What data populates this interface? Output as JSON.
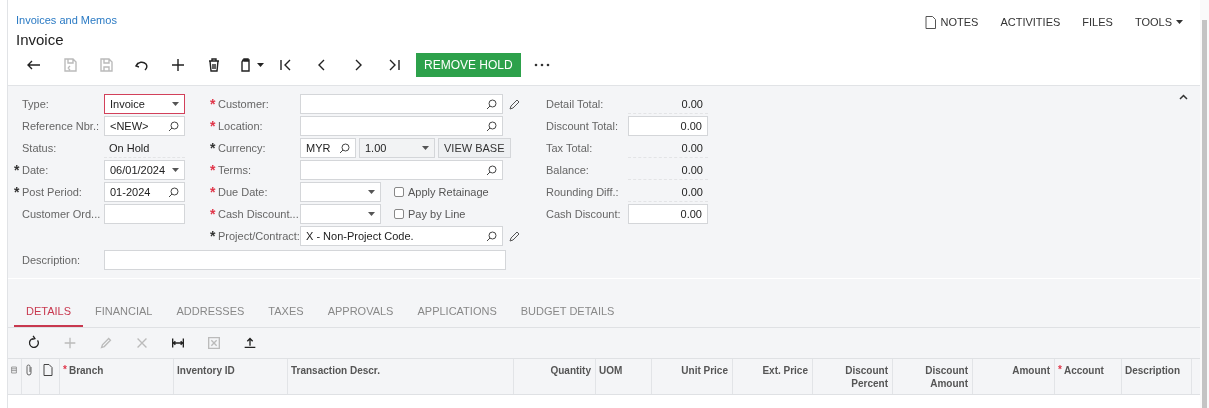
{
  "breadcrumb": "Invoices and Memos",
  "title": "Invoice",
  "top_links": [
    {
      "label": "NOTES"
    },
    {
      "label": "ACTIVITIES"
    },
    {
      "label": "FILES"
    },
    {
      "label": "TOOLS"
    }
  ],
  "toolbar": [
    {
      "disabled": false
    },
    {
      "disabled": true
    },
    {
      "disabled": true
    },
    {
      "disabled": false
    },
    {
      "disabled": false
    },
    {
      "disabled": false
    },
    {
      "disabled": false
    },
    {
      "disabled": false
    },
    {
      "disabled": false
    },
    {
      "disabled": false
    },
    {
      "disabled": false
    }
  ],
  "primary_button": "REMOVE HOLD",
  "left_fields": [
    {
      "label": "Type:",
      "kind": "select",
      "value": "Invoice",
      "highlighted": true
    },
    {
      "label": "Reference Nbr.:",
      "kind": "lookup",
      "value": "<NEW>",
      "highlighted": false
    },
    {
      "label": "Status:",
      "kind": "text",
      "value": "On Hold"
    },
    {
      "label": "Date:",
      "kind": "select",
      "value": "06/01/2024",
      "mark": "*",
      "color": "#333333",
      "highlighted": false
    },
    {
      "label": "Post Period:",
      "kind": "lookup",
      "value": "01-2024",
      "mark": "*",
      "color": "#333333",
      "highlighted": false
    },
    {
      "label": "Customer Ord...",
      "kind": "input",
      "highlighted": false
    }
  ],
  "middle_fields": [
    {
      "label": "Customer:",
      "kind": "lookup",
      "mark": "*",
      "color": "#e0364a",
      "edit": true
    },
    {
      "label": "Location:",
      "kind": "lookup",
      "mark": "*",
      "color": "#e0364a",
      "edit": false
    },
    {
      "label": "Currency:",
      "kind": "currency",
      "mark": "*",
      "color": "#333333",
      "edit": false,
      "code": "MYR",
      "rate": "1.00",
      "button": "VIEW BASE"
    },
    {
      "label": "Terms:",
      "kind": "lookup",
      "mark": "*",
      "color": "#e0364a",
      "edit": false
    },
    {
      "label": "Due Date:",
      "kind": "select",
      "mark": "*",
      "color": "#e0364a",
      "edit": false,
      "checkbox": {
        "label": "Apply Retainage",
        "checked": false
      }
    },
    {
      "label": "Cash Discount...",
      "kind": "select",
      "mark": "*",
      "color": "#e0364a",
      "edit": false,
      "checkbox": {
        "label": "Pay by Line",
        "checked": false
      }
    },
    {
      "label": "Project/Contract:",
      "kind": "lookup",
      "value": "X - Non-Project Code.",
      "mark": "*",
      "color": "#333333",
      "edit": true
    }
  ],
  "description": {
    "label": "Description:"
  },
  "totals": [
    {
      "label": "Detail Total:",
      "kind": "text",
      "value": "0.00"
    },
    {
      "label": "Discount Total:",
      "kind": "input",
      "value": "0.00"
    },
    {
      "label": "Tax Total:",
      "kind": "text",
      "value": "0.00"
    },
    {
      "label": "Balance:",
      "kind": "text",
      "value": "0.00"
    },
    {
      "label": "Rounding Diff.:",
      "kind": "text",
      "value": "0.00"
    },
    {
      "label": "Cash Discount:",
      "kind": "input",
      "value": "0.00"
    }
  ],
  "tabs": [
    {
      "label": "DETAILS",
      "selected": true
    },
    {
      "label": "FINANCIAL",
      "selected": false
    },
    {
      "label": "ADDRESSES",
      "selected": false
    },
    {
      "label": "TAXES",
      "selected": false
    },
    {
      "label": "APPROVALS",
      "selected": false
    },
    {
      "label": "APPLICATIONS",
      "selected": false
    },
    {
      "label": "BUDGET DETAILS",
      "selected": false
    }
  ],
  "grid_toolbar": [
    {
      "disabled": false
    },
    {
      "disabled": true
    },
    {
      "disabled": true
    },
    {
      "disabled": true
    },
    {
      "disabled": false
    },
    {
      "disabled": true
    },
    {
      "disabled": false
    }
  ],
  "columns": [
    {
      "kind": "icon"
    },
    {
      "kind": "icon"
    },
    {
      "kind": "icon"
    },
    {
      "kind": "text",
      "label": "Branch",
      "mark": "*"
    },
    {
      "kind": "text",
      "label": "Inventory ID"
    },
    {
      "kind": "text",
      "label": "Transaction Descr."
    },
    {
      "kind": "text",
      "label": "Quantity"
    },
    {
      "kind": "text",
      "label": "UOM"
    },
    {
      "kind": "text",
      "label": "Unit Price"
    },
    {
      "kind": "text",
      "label": "Ext. Price"
    },
    {
      "kind": "text",
      "label": "Discount Percent"
    },
    {
      "kind": "text",
      "label": "Discount Amount"
    },
    {
      "kind": "text",
      "label": "Amount"
    },
    {
      "kind": "text",
      "label": "Account",
      "mark": "*"
    },
    {
      "kind": "text",
      "label": "Description"
    }
  ]
}
